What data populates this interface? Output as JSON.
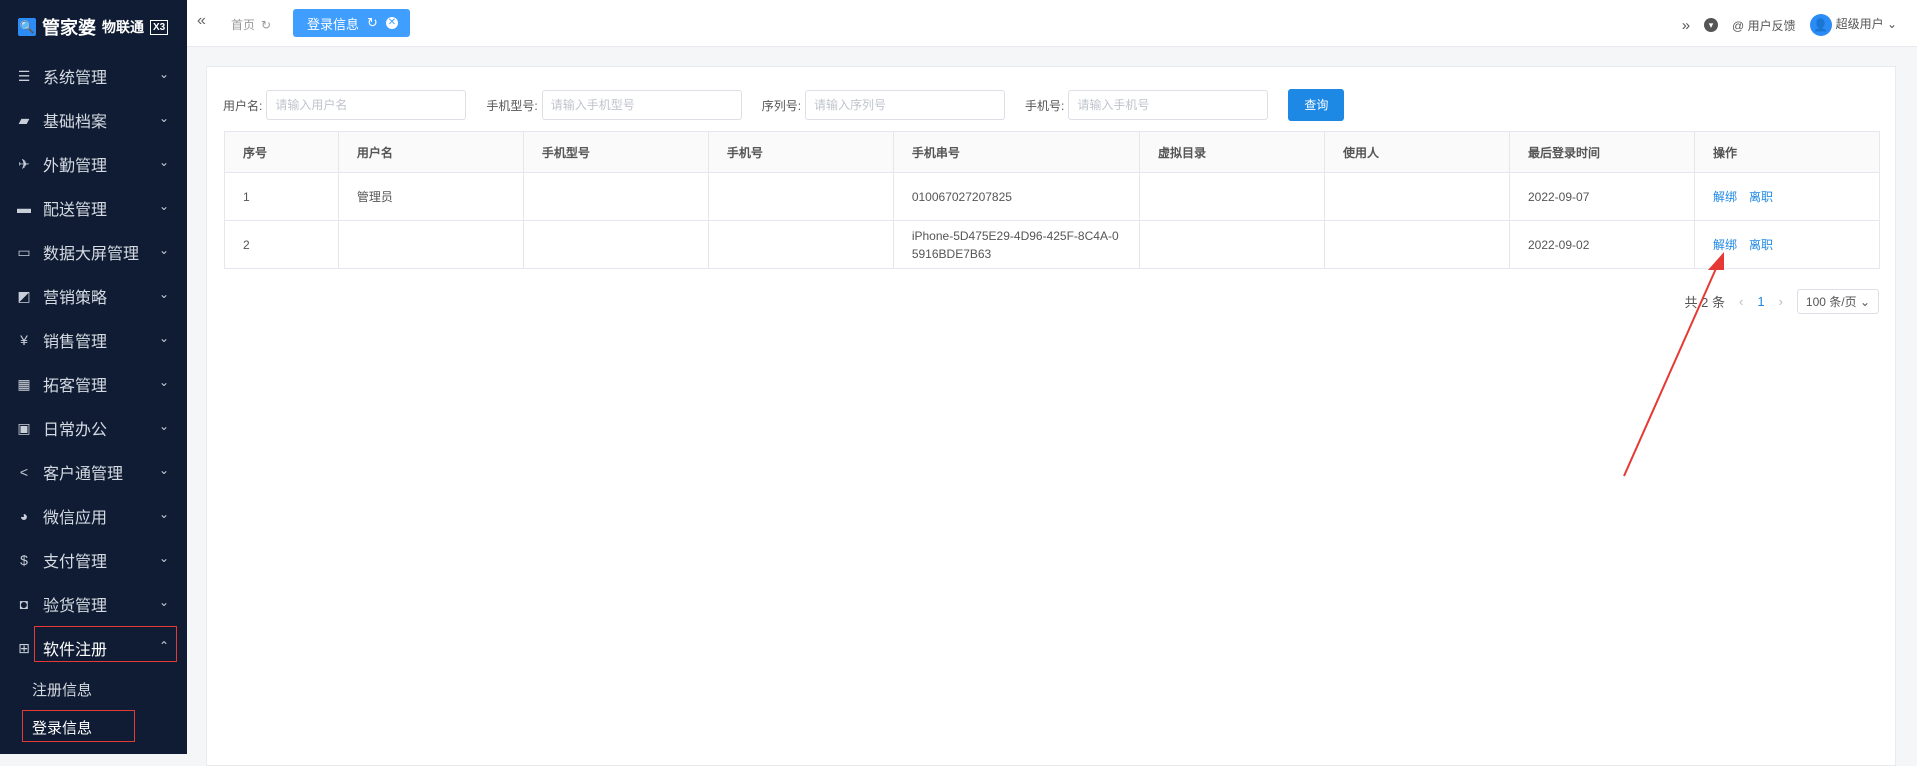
{
  "brand": {
    "name": "管家婆",
    "sub": "物联通",
    "box": "X3"
  },
  "sidebar": {
    "items": [
      {
        "label": "系统管理",
        "icon": "sliders-icon",
        "glyph": "☰"
      },
      {
        "label": "基础档案",
        "icon": "folder-icon",
        "glyph": "▰"
      },
      {
        "label": "外勤管理",
        "icon": "plane-icon",
        "glyph": "✈"
      },
      {
        "label": "配送管理",
        "icon": "truck-icon",
        "glyph": "▬"
      },
      {
        "label": "数据大屏管理",
        "icon": "monitor-icon",
        "glyph": "▭"
      },
      {
        "label": "营销策略",
        "icon": "chart-icon",
        "glyph": "◩"
      },
      {
        "label": "销售管理",
        "icon": "yen-icon",
        "glyph": "¥"
      },
      {
        "label": "拓客管理",
        "icon": "grid-icon",
        "glyph": "▦"
      },
      {
        "label": "日常办公",
        "icon": "briefcase-icon",
        "glyph": "▣"
      },
      {
        "label": "客户通管理",
        "icon": "share-icon",
        "glyph": "<"
      },
      {
        "label": "微信应用",
        "icon": "wechat-icon",
        "glyph": "◕"
      },
      {
        "label": "支付管理",
        "icon": "dollar-icon",
        "glyph": "$"
      },
      {
        "label": "验货管理",
        "icon": "inbox-icon",
        "glyph": "◘"
      }
    ],
    "open_item": {
      "label": "软件注册",
      "icon": "sitemap-icon",
      "glyph": "⊞"
    },
    "sub_items": [
      {
        "label": "注册信息"
      },
      {
        "label": "登录信息"
      }
    ]
  },
  "topbar": {
    "home_tab": "首页",
    "active_tab": "登录信息",
    "feedback": "@ 用户反馈",
    "user": "超级用户"
  },
  "filters": {
    "username_label": "用户名:",
    "username_placeholder": "请输入用户名",
    "model_label": "手机型号:",
    "model_placeholder": "请输入手机型号",
    "serial_label": "序列号:",
    "serial_placeholder": "请输入序列号",
    "phone_label": "手机号:",
    "phone_placeholder": "请输入手机号",
    "query_button": "查询"
  },
  "table": {
    "headers": [
      "序号",
      "用户名",
      "手机型号",
      "手机号",
      "手机串号",
      "虚拟目录",
      "使用人",
      "最后登录时间",
      "操作"
    ],
    "rows": [
      {
        "no": "1",
        "user": "管理员",
        "model": "",
        "phone": "",
        "imei": "010067027207825",
        "vdir": "",
        "owner": "",
        "last_login": "2022-09-07",
        "op1": "解绑",
        "op2": "离职"
      },
      {
        "no": "2",
        "user": "",
        "model": "",
        "phone": "",
        "imei": "iPhone-5D475E29-4D96-425F-8C4A-05916BDE7B63",
        "vdir": "",
        "owner": "",
        "last_login": "2022-09-02",
        "op1": "解绑",
        "op2": "离职"
      }
    ]
  },
  "pager": {
    "total": "共 2 条",
    "page": "1",
    "size": "100 条/页"
  },
  "colors": {
    "sidebar_bg": "#0f1c33",
    "accent": "#409eff",
    "annotation": "#e53935"
  }
}
